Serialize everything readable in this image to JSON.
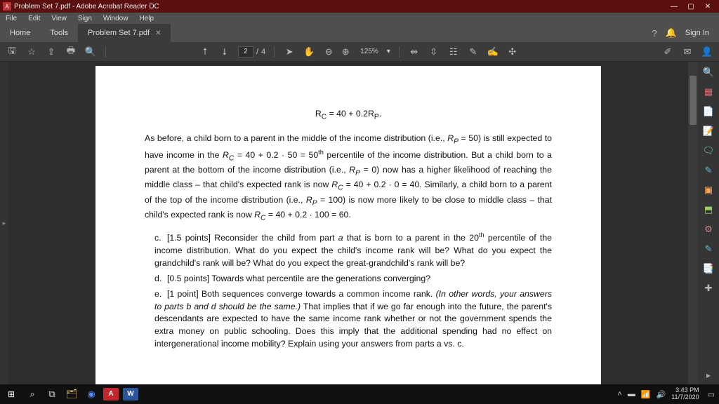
{
  "window": {
    "title": "Problem Set 7.pdf - Adobe Acrobat Reader DC",
    "min": "—",
    "max": "▢",
    "close": "✕"
  },
  "menu": {
    "file": "File",
    "edit": "Edit",
    "view": "View",
    "sign": "Sign",
    "window": "Window",
    "help": "Help"
  },
  "tabs": {
    "home": "Home",
    "tools": "Tools",
    "doc": "Problem Set 7.pdf",
    "close_x": "✕",
    "help_icon": "?",
    "bell_icon": "🔔",
    "signin": "Sign In"
  },
  "toolbar": {
    "page_current": "2",
    "page_sep": "/",
    "page_total": "4",
    "zoom_value": "125%",
    "zoom_caret": "▾"
  },
  "doc": {
    "equation": "R_C = 40 + 0.2R_P.",
    "para1": "As before, a child born to a parent in the middle of the income distribution (i.e., R_P = 50) is still expected to have income in the R_C = 40 + 0.2 · 50 = 50th percentile of the income distribution. But a child born to a parent at the bottom of the income distribution (i.e., R_P = 0) now has a higher likelihood of reaching the middle class – that child's expected rank is now R_C = 40 + 0.2 · 0 = 40. Similarly, a child born to a parent of the top of the income distribution (i.e., R_P = 100) is now more likely to be close to middle class – that child's expected rank is now R_C = 40 + 0.2 · 100 = 60.",
    "item_c": "[1.5 points] Reconsider the child from part a that is born to a parent in the 20th percentile of the income distribution. What do you expect the child's income rank will be? What do you expect the grandchild's rank will be? What do you expect the great-grandchild's rank will be?",
    "item_d": "[0.5 points] Towards what percentile are the generations converging?",
    "item_e_lead": "[1 point] Both sequences converge towards a common income rank. ",
    "item_e_ital": "(In other words, your answers to parts b and d should be the same.)",
    "item_e_tail": " That implies that if we go far enough into the future, the parent's descendants are expected to have the same income rank whether or not the government spends the extra money on public schooling. Does this imply that the additional spending had no effect on intergenerational income mobility? Explain using your answers from parts a vs. c.",
    "lab_c": "c.",
    "lab_d": "d.",
    "lab_e": "e."
  },
  "sidetools": {
    "t1": "🔍",
    "t2": "▦",
    "t3": "📄",
    "t4": "📝",
    "t5": "🗨",
    "t6": "✎",
    "t7": "▣",
    "t8": "⬒",
    "t9": "⚙",
    "t10": "✎",
    "t11": "📑",
    "t12": "✚",
    "expand": "▸"
  },
  "taskbar": {
    "start": "⊞",
    "search": "⌕",
    "cortana": "○",
    "explorer": "🗂",
    "chrome": "◉",
    "acro": "A",
    "word": "W",
    "tray_up": "˄",
    "tray_batt": "▬",
    "tray_wifi": "📶",
    "tray_vol": "🔊",
    "tray_action": "▭",
    "time": "3:43 PM",
    "date": "11/7/2020"
  }
}
